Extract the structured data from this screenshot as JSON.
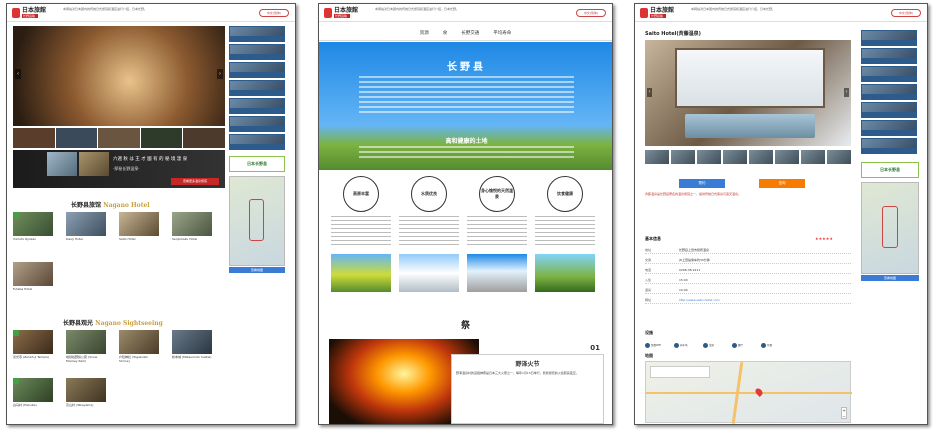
{
  "brand": {
    "name": "日本旅館",
    "tag": "长野县版",
    "accent": "#c62828",
    "nav_blue": "#2d5b8c"
  },
  "header": {
    "intro": "本网站对日本国内的传统日式旅馆和酒店进行介绍，日本长野。",
    "lang_button": "中文(简体)"
  },
  "p1": {
    "banner_text": "六週 秋 は 王 才 國 有 的 秘 境 溫 泉",
    "banner_button": "查看更多温泉旅馆",
    "banner_sub": "·探秘长野温泉·",
    "nagano_banner": "日本长野县",
    "map_button": "查看地图",
    "hotel_title_cn": "长野县旅馆",
    "hotel_title_en": "Nagano Hotel",
    "hotels": [
      {
        "label": "Yumoto Ryokan"
      },
      {
        "label": "Kisoji Hotel"
      },
      {
        "label": "Saito Hotel"
      },
      {
        "label": "Senjinkaku Hotel"
      },
      {
        "label": "Futaba Hotel"
      }
    ],
    "sight_title_cn": "长野县观光",
    "sight_title_en": "Nagano Sightseeing",
    "sights": [
      {
        "label": "善光寺 (Zenkō-ji Temple)"
      },
      {
        "label": "地狱谷野猿公苑 (Snow Monkey Park)"
      },
      {
        "label": "户隐神社 (Togakushi Shrine)"
      },
      {
        "label": "松本城 (Matsumoto Castle)"
      },
      {
        "label": "白马村 (Hakuba)"
      },
      {
        "label": "高山村 (Takayama)"
      }
    ]
  },
  "p2": {
    "nav": [
      "资源",
      "食",
      "长野交通",
      "平均寿命"
    ],
    "hero_title": "长野县",
    "hero_subtitle": "高和健康的土地",
    "circles": [
      "高原丰富",
      "水质优良",
      "身心愉悦的天然温泉",
      "饮食健康"
    ],
    "section_title": "祭",
    "event_number": "01",
    "event_title": "野泽火节",
    "event_desc": "野泽温泉村的道祖神祭是日本三大火祭之一，每年1月15日举行，熊熊燃烧的火焰照亮夜空。"
  },
  "p3": {
    "hotel_name": "Saito Hotel(斉藤温泉)",
    "btn_left": "预约",
    "btn_right": "咨询",
    "description": "斉藤温泉是长野县著名的温泉旅馆之一，提供传统日式客房与露天温泉。",
    "info_heading": "基本信息",
    "rating": "★★★★★",
    "rows": [
      {
        "k": "地址",
        "v": "长野县上田市别所温泉"
      },
      {
        "k": "交通",
        "v": "JR上田站乘车约30分钟"
      },
      {
        "k": "电话",
        "v": "0268-38-2211"
      },
      {
        "k": "入住",
        "v": "15:00"
      },
      {
        "k": "退房",
        "v": "10:00"
      },
      {
        "k": "网址",
        "v": "http://www.saito-hotel.com"
      }
    ],
    "facilities_heading": "设施",
    "facilities": [
      "免费WiFi",
      "停车场",
      "温泉",
      "餐厅",
      "禁烟"
    ],
    "map_heading": "地图"
  }
}
